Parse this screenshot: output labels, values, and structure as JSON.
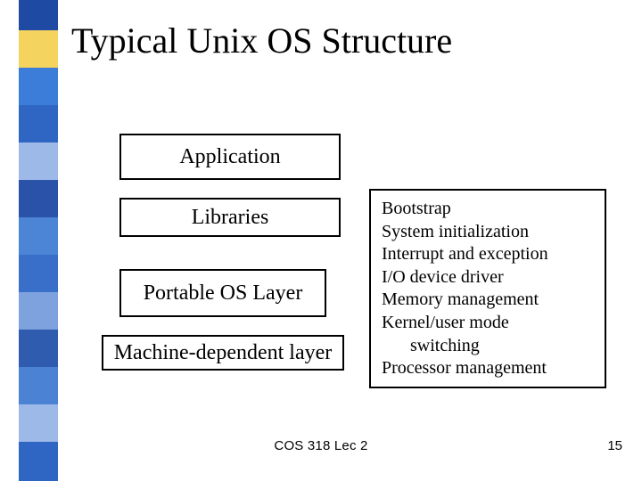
{
  "title": "Typical Unix OS Structure",
  "boxes": {
    "application": "Application",
    "libraries": "Libraries",
    "portable_os": "Portable OS Layer",
    "machine_dep": "Machine-dependent layer"
  },
  "info": {
    "lines": [
      "Bootstrap",
      "System initialization",
      "Interrupt and exception",
      "I/O device driver",
      "Memory management",
      "Kernel/user mode"
    ],
    "indent_line": "switching",
    "last_line": "Processor management"
  },
  "footer": {
    "center": "COS 318 Lec 2",
    "page": "15"
  },
  "sidebar_colors": [
    "#1f4aa3",
    "#f4d35e",
    "#3c7dd9",
    "#2f66c4",
    "#9db9e8",
    "#2a52a8",
    "#4c84d6",
    "#3a6fc9",
    "#7da2dd",
    "#305cb0",
    "#4b82d4",
    "#9db9e8",
    "#2f66c4"
  ]
}
